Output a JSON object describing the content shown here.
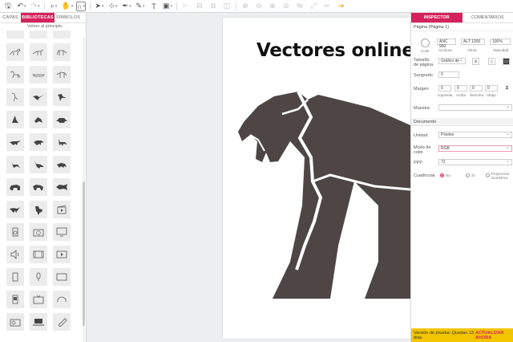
{
  "toolbar": {
    "icons": [
      "save-icon",
      "undo-icon",
      "redo-icon",
      "zoom-icon",
      "hand-icon",
      "magnet-icon",
      "select-icon",
      "pen-icon",
      "text-icon",
      "image-icon",
      "align-icons",
      "boolean-icons",
      "flip-icon",
      "export-icon"
    ]
  },
  "library": {
    "tabs": [
      "CAPAS",
      "BIBLIOTECAS",
      "SÍMBOLOS"
    ],
    "back_label": "Volver al principio"
  },
  "canvas": {
    "title": "Vectores online",
    "colors": {
      "panther": "#4d4644",
      "page": "#ffffff",
      "canvas_bg": "#eceeef"
    }
  },
  "inspector": {
    "tabs": [
      "INSPECTOR",
      "COMENTARIOS"
    ],
    "page_header": "Página (Página 1)",
    "page_props": {
      "color_label": "Color",
      "width_value": "ANC 900",
      "width_label": "Anchura",
      "height_value": "ALT 1200",
      "height_label": "Altura",
      "opacity_value": "100%",
      "opacity_label": "Opacidad"
    },
    "page_size_label": "Tamaño de página",
    "page_size_value": "Gráfico de ",
    "bleed_label": "Sangrado",
    "bleed_value": "0",
    "margins_label": "Margen",
    "margins": [
      {
        "value": "0",
        "label": "Izquierda"
      },
      {
        "value": "0",
        "label": "Arriba"
      },
      {
        "value": "0",
        "label": "Derecha"
      },
      {
        "value": "0",
        "label": "Abajo"
      }
    ],
    "master_label": "Muestra",
    "doc_header": "Documento",
    "unit_label": "Unidad",
    "unit_value": "Píxeles",
    "color_mode_label": "Modo de color",
    "color_mode_value": "RGB",
    "ppi_label": "PPP",
    "ppi_value": "72",
    "grid_label": "Cuadrícula",
    "grid_options": [
      "No",
      "Sí",
      "Proyección isométrica"
    ],
    "grid_selected": "No",
    "trial_message": "Versión de prueba: Quedan 13 días",
    "trial_action": "ACTUALIZAR AHORA",
    "accent_color": "#d6225c"
  }
}
